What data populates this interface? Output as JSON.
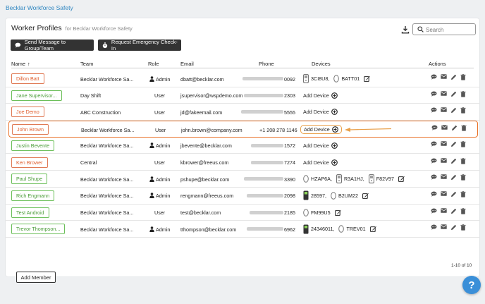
{
  "breadcrumb": "Becklar Workforce Safety",
  "header": {
    "title": "Worker Profiles",
    "subtitle": "for Becklar Workforce Safety",
    "search_placeholder": "Search"
  },
  "toolbar": {
    "send_message": "Send Message to Group/Team",
    "emergency_checkin": "Request Emergency Check-In"
  },
  "columns": {
    "name": "Name",
    "sort_arrow": "↑",
    "team": "Team",
    "role": "Role",
    "email": "Email",
    "phone": "Phone",
    "devices": "Devices",
    "actions": "Actions"
  },
  "rows": [
    {
      "name": "Dillon Batt",
      "color": "red",
      "team": "Becklar Workforce Sa...",
      "role": "Admin",
      "email": "dbatt@becklar.com",
      "phone": "0092",
      "devices": [
        {
          "type": "tall",
          "label": "3CI8U8,"
        },
        {
          "type": "oval",
          "label": "BATT01"
        }
      ]
    },
    {
      "name": "Jane Supervisor...",
      "color": "green",
      "team": "Day Shift",
      "role": "User",
      "email": "jsupervisor@wspdemo.com",
      "phone": "2303",
      "devices": []
    },
    {
      "name": "Joe Demo",
      "color": "red",
      "team": "ABC Construction",
      "role": "User",
      "email": "jd@fakeemail.com",
      "phone": "5555",
      "devices": []
    },
    {
      "name": "John Brown",
      "color": "red",
      "team": "Becklar Workforce Sa...",
      "role": "User",
      "email": "john.brown@company.com",
      "phone": "+1 208 278 1146",
      "devices": [],
      "highlight": true
    },
    {
      "name": "Justin Bevente",
      "color": "green",
      "team": "Becklar Workforce Sa...",
      "role": "Admin",
      "email": "jbevente@becklar.com",
      "phone": "1572",
      "devices": []
    },
    {
      "name": "Ken Brower",
      "color": "red",
      "team": "Central",
      "role": "User",
      "email": "kbrower@freeus.com",
      "phone": "7274",
      "devices": []
    },
    {
      "name": "Paul Shupe",
      "color": "green",
      "team": "Becklar Workforce Sa...",
      "role": "Admin",
      "email": "pshupe@becklar.com",
      "phone": "3390",
      "devices": [
        {
          "type": "oval",
          "label": "HZAP6A,"
        },
        {
          "type": "tall",
          "label": "R3A1HJ,"
        },
        {
          "type": "tall",
          "label": "F82V97"
        }
      ]
    },
    {
      "name": "Rich Engmann",
      "color": "green",
      "team": "Becklar Workforce Sa...",
      "role": "Admin",
      "email": "rengmann@freeus.com",
      "phone": "2098",
      "devices": [
        {
          "type": "dark",
          "label": "28597,"
        },
        {
          "type": "oval",
          "label": "B2UM22"
        }
      ]
    },
    {
      "name": "Test Android",
      "color": "green",
      "team": "Becklar Workforce Sa...",
      "role": "User",
      "email": "test@becklar.com",
      "phone": "2185",
      "devices": [
        {
          "type": "oval",
          "label": "FM99U5"
        }
      ]
    },
    {
      "name": "Trevor Thompson...",
      "color": "green",
      "team": "Becklar Workforce Sa...",
      "role": "Admin",
      "email": "tthompson@becklar.com",
      "phone": "6962",
      "devices": [
        {
          "type": "dark",
          "label": "24346011,"
        },
        {
          "type": "oval",
          "label": "TREV01"
        }
      ]
    }
  ],
  "add_device_label": "Add Device",
  "pagination": "1-10 of 10",
  "add_member": "Add Member",
  "help": "?",
  "colors": {
    "accent_orange": "#e9732a",
    "red_name": "#e06030",
    "green_name": "#4a9c38",
    "link_blue": "#2e86c1"
  },
  "icons": [
    "download-icon",
    "search-icon",
    "chat-icon",
    "stopwatch-icon",
    "user-icon",
    "device-icon",
    "add-circle-icon",
    "edit-icon",
    "mail-icon",
    "pencil-icon",
    "trash-icon"
  ]
}
